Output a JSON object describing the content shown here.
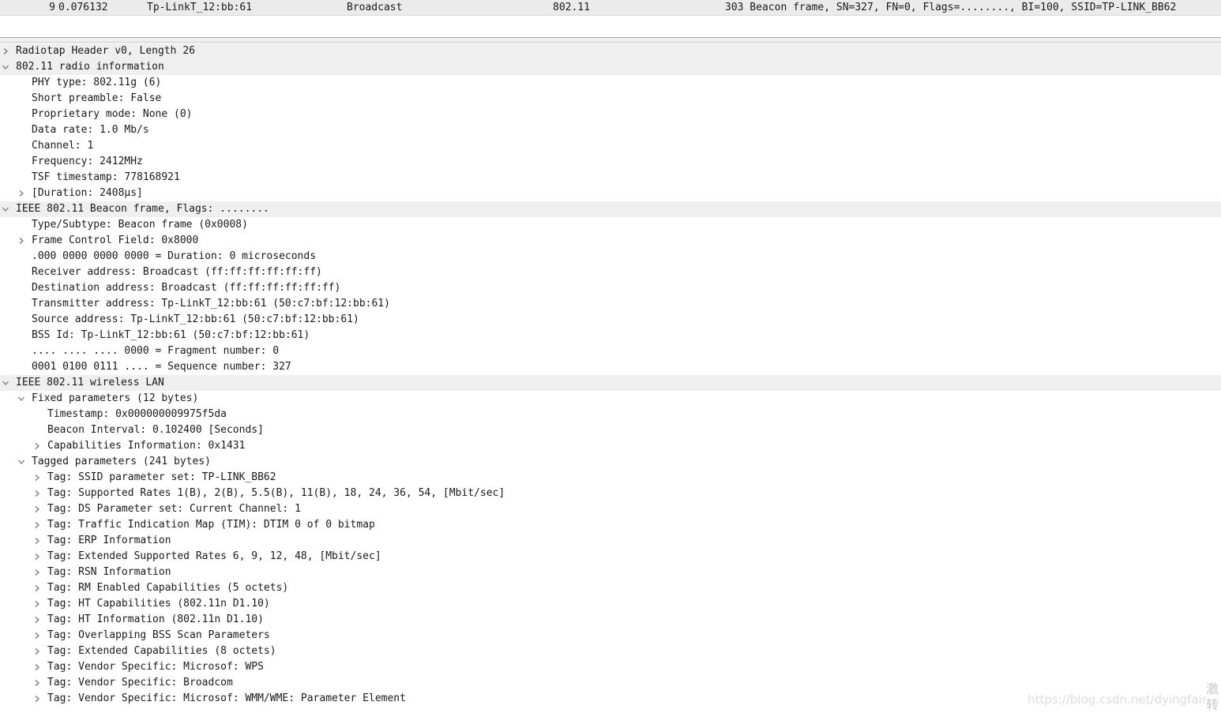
{
  "packet_list": {
    "selected_row": {
      "no": "9",
      "time": "0.076132",
      "source": "Tp-LinkT_12:bb:61",
      "destination": "Broadcast",
      "protocol": "802.11",
      "info": "303 Beacon frame, SN=327, FN=0, Flags=........, BI=100, SSID=TP-LINK_BB62"
    }
  },
  "details": {
    "rows": [
      {
        "text": "Radiotap Header v0, Length 26",
        "level": 0,
        "state": "collapsed"
      },
      {
        "text": "802.11 radio information",
        "level": 0,
        "state": "expanded"
      },
      {
        "text": "PHY type: 802.11g (6)",
        "level": 1,
        "state": "leaf"
      },
      {
        "text": "Short preamble: False",
        "level": 1,
        "state": "leaf"
      },
      {
        "text": "Proprietary mode: None (0)",
        "level": 1,
        "state": "leaf"
      },
      {
        "text": "Data rate: 1.0 Mb/s",
        "level": 1,
        "state": "leaf"
      },
      {
        "text": "Channel: 1",
        "level": 1,
        "state": "leaf"
      },
      {
        "text": "Frequency: 2412MHz",
        "level": 1,
        "state": "leaf"
      },
      {
        "text": "TSF timestamp: 778168921",
        "level": 1,
        "state": "leaf"
      },
      {
        "text": "[Duration: 2408µs]",
        "level": 1,
        "state": "collapsed"
      },
      {
        "text": "IEEE 802.11 Beacon frame, Flags: ........",
        "level": 0,
        "state": "expanded"
      },
      {
        "text": "Type/Subtype: Beacon frame (0x0008)",
        "level": 1,
        "state": "leaf"
      },
      {
        "text": "Frame Control Field: 0x8000",
        "level": 1,
        "state": "collapsed"
      },
      {
        "text": ".000 0000 0000 0000 = Duration: 0 microseconds",
        "level": 1,
        "state": "leaf"
      },
      {
        "text": "Receiver address: Broadcast (ff:ff:ff:ff:ff:ff)",
        "level": 1,
        "state": "leaf"
      },
      {
        "text": "Destination address: Broadcast (ff:ff:ff:ff:ff:ff)",
        "level": 1,
        "state": "leaf"
      },
      {
        "text": "Transmitter address: Tp-LinkT_12:bb:61 (50:c7:bf:12:bb:61)",
        "level": 1,
        "state": "leaf"
      },
      {
        "text": "Source address: Tp-LinkT_12:bb:61 (50:c7:bf:12:bb:61)",
        "level": 1,
        "state": "leaf"
      },
      {
        "text": "BSS Id: Tp-LinkT_12:bb:61 (50:c7:bf:12:bb:61)",
        "level": 1,
        "state": "leaf"
      },
      {
        "text": ".... .... .... 0000 = Fragment number: 0",
        "level": 1,
        "state": "leaf"
      },
      {
        "text": "0001 0100 0111 .... = Sequence number: 327",
        "level": 1,
        "state": "leaf"
      },
      {
        "text": "IEEE 802.11 wireless LAN",
        "level": 0,
        "state": "expanded"
      },
      {
        "text": "Fixed parameters (12 bytes)",
        "level": 1,
        "state": "expanded"
      },
      {
        "text": "Timestamp: 0x000000009975f5da",
        "level": 2,
        "state": "leaf"
      },
      {
        "text": "Beacon Interval: 0.102400 [Seconds]",
        "level": 2,
        "state": "leaf"
      },
      {
        "text": "Capabilities Information: 0x1431",
        "level": 2,
        "state": "collapsed"
      },
      {
        "text": "Tagged parameters (241 bytes)",
        "level": 1,
        "state": "expanded"
      },
      {
        "text": "Tag: SSID parameter set: TP-LINK_BB62",
        "level": 2,
        "state": "collapsed"
      },
      {
        "text": "Tag: Supported Rates 1(B), 2(B), 5.5(B), 11(B), 18, 24, 36, 54, [Mbit/sec]",
        "level": 2,
        "state": "collapsed"
      },
      {
        "text": "Tag: DS Parameter set: Current Channel: 1",
        "level": 2,
        "state": "collapsed"
      },
      {
        "text": "Tag: Traffic Indication Map (TIM): DTIM 0 of 0 bitmap",
        "level": 2,
        "state": "collapsed"
      },
      {
        "text": "Tag: ERP Information",
        "level": 2,
        "state": "collapsed"
      },
      {
        "text": "Tag: Extended Supported Rates 6, 9, 12, 48, [Mbit/sec]",
        "level": 2,
        "state": "collapsed"
      },
      {
        "text": "Tag: RSN Information",
        "level": 2,
        "state": "collapsed"
      },
      {
        "text": "Tag: RM Enabled Capabilities (5 octets)",
        "level": 2,
        "state": "collapsed"
      },
      {
        "text": "Tag: HT Capabilities (802.11n D1.10)",
        "level": 2,
        "state": "collapsed"
      },
      {
        "text": "Tag: HT Information (802.11n D1.10)",
        "level": 2,
        "state": "collapsed"
      },
      {
        "text": "Tag: Overlapping BSS Scan Parameters",
        "level": 2,
        "state": "collapsed"
      },
      {
        "text": "Tag: Extended Capabilities (8 octets)",
        "level": 2,
        "state": "collapsed"
      },
      {
        "text": "Tag: Vendor Specific: Microsof: WPS",
        "level": 2,
        "state": "collapsed"
      },
      {
        "text": "Tag: Vendor Specific: Broadcom",
        "level": 2,
        "state": "collapsed"
      },
      {
        "text": "Tag: Vendor Specific: Microsof: WMM/WME: Parameter Element",
        "level": 2,
        "state": "collapsed"
      }
    ]
  },
  "watermark": {
    "text": "https://blog.csdn.net/dyingfair",
    "badge": "激转"
  },
  "colors": {
    "top_level_row_bg": "#efefef",
    "selected_packet_bg": "#ebebeb",
    "arrow": "#707070"
  },
  "icons": {
    "collapsed": "chevron-right-icon",
    "expanded": "chevron-down-icon"
  }
}
